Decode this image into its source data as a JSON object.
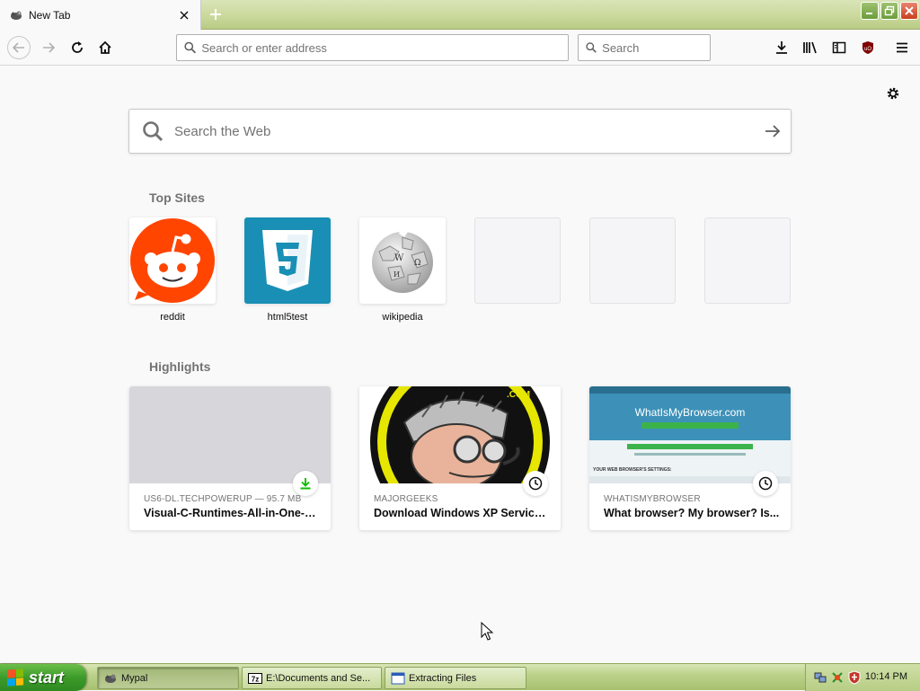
{
  "browser": {
    "tab": {
      "title": "New Tab",
      "close_icon": "close-icon"
    },
    "new_tab_icon": "plus-icon",
    "window_buttons": [
      "minimize",
      "restore",
      "close"
    ]
  },
  "navbar": {
    "url_placeholder": "Search or enter address",
    "search_placeholder": "Search"
  },
  "newtab": {
    "web_search_placeholder": "Search the Web",
    "top_sites_heading": "Top Sites",
    "top_sites": [
      {
        "label": "reddit",
        "kind": "reddit"
      },
      {
        "label": "html5test",
        "kind": "html5"
      },
      {
        "label": "wikipedia",
        "kind": "wikipedia"
      },
      {
        "label": "",
        "kind": "empty"
      },
      {
        "label": "",
        "kind": "empty"
      },
      {
        "label": "",
        "kind": "empty"
      }
    ],
    "highlights_heading": "Highlights",
    "highlights": [
      {
        "source": "US6-DL.TECHPOWERUP — 95.7 MB",
        "title": "Visual-C-Runtimes-All-in-One-N...",
        "badge": "download-icon"
      },
      {
        "source": "MAJORGEEKS",
        "title": "Download Windows XP Service ...",
        "badge": "clock-icon",
        "thumb_text": ".COM"
      },
      {
        "source": "WHATISMYBROWSER",
        "title": "What browser? My browser? Is...",
        "badge": "clock-icon",
        "thumb_text": "WhatIsMyBrowser.com",
        "thumb_sub": "YOUR WEB BROWSER'S SETTINGS:"
      }
    ]
  },
  "taskbar": {
    "start_label": "start",
    "tasks": [
      {
        "label": "Mypal",
        "active": true
      },
      {
        "label": "E:\\Documents and Se...",
        "active": false
      },
      {
        "label": "Extracting Files",
        "active": false
      }
    ],
    "clock": "10:14 PM"
  },
  "colors": {
    "reddit": "#ff4500",
    "html5": "#1a8fb5",
    "accent": "#0a84ff",
    "download_green": "#12bc00",
    "taskbar_green": "#bcd28b"
  }
}
